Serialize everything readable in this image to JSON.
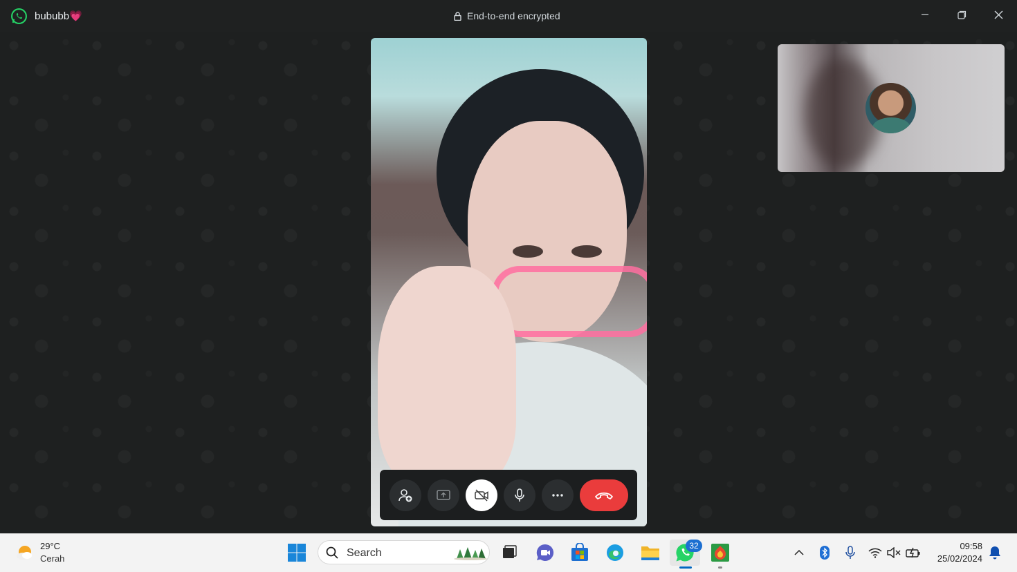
{
  "titlebar": {
    "contact_name": "bububb",
    "contact_emoji": "💗",
    "encryption_label": "End-to-end encrypted",
    "controls": [
      "minimize-icon",
      "restore-icon",
      "close-icon"
    ]
  },
  "call": {
    "controls": [
      {
        "name": "add-participant-button",
        "icon": "person-add-icon"
      },
      {
        "name": "share-screen-button",
        "icon": "share-screen-icon"
      },
      {
        "name": "camera-toggle-button",
        "icon": "video-off-icon",
        "state": "off"
      },
      {
        "name": "microphone-button",
        "icon": "microphone-icon"
      },
      {
        "name": "more-options-button",
        "icon": "more-icon"
      },
      {
        "name": "end-call-button",
        "icon": "hang-up-icon"
      }
    ]
  },
  "taskbar": {
    "weather": {
      "temperature": "29°C",
      "condition": "Cerah"
    },
    "search_placeholder": "Search",
    "whatsapp_badge": "32",
    "clock": {
      "time": "09:58",
      "date": "25/02/2024"
    }
  },
  "colors": {
    "accent_green": "#25d366",
    "end_call_red": "#ea3c3c",
    "badge_blue": "#1c6fd1"
  }
}
